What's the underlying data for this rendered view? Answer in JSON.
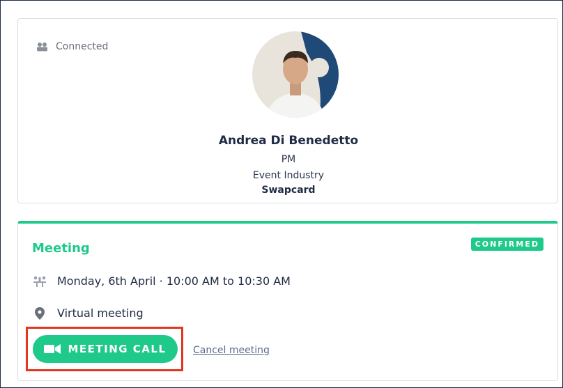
{
  "profile": {
    "status": "Connected",
    "name": "Andrea Di Benedetto",
    "role": "PM",
    "industry": "Event Industry",
    "company": "Swapcard"
  },
  "meeting": {
    "title": "Meeting",
    "status_badge": "CONFIRMED",
    "datetime": "Monday, 6th April · 10:00 AM to 10:30 AM",
    "location": "Virtual meeting",
    "call_button_label": "MEETING CALL",
    "cancel_label": "Cancel meeting"
  },
  "colors": {
    "accent_green": "#1ec98a",
    "highlight_red": "#e2361f",
    "text_dark": "#1f2a44"
  },
  "icons": {
    "connected": "people-icon",
    "time": "meeting-table-icon",
    "location": "location-pin-icon",
    "call": "video-camera-icon"
  }
}
